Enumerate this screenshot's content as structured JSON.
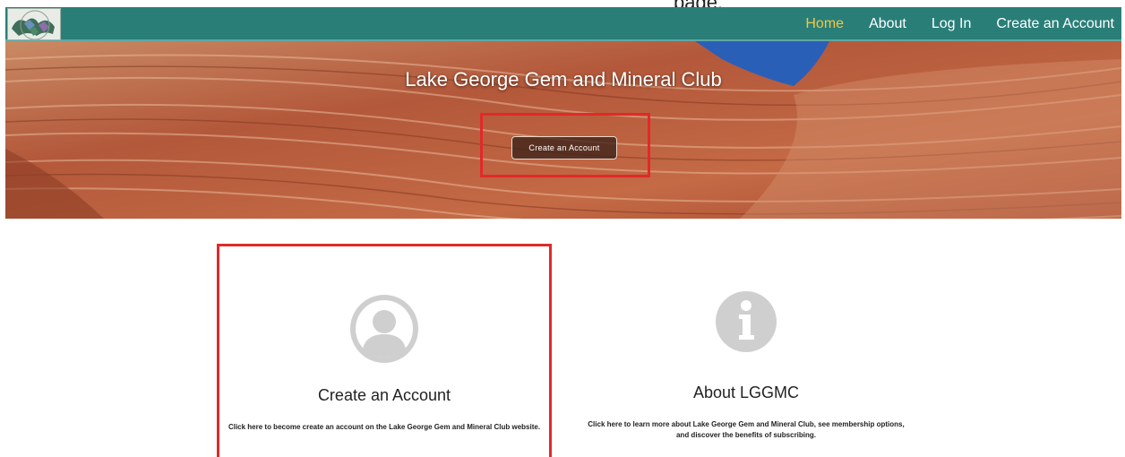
{
  "top_strip": {
    "tail_text": "page."
  },
  "nav": {
    "items": [
      {
        "label": "Home",
        "active": true
      },
      {
        "label": "About",
        "active": false
      },
      {
        "label": "Log In",
        "active": false
      },
      {
        "label": "Create an Account",
        "active": false
      }
    ],
    "bar_color": "#2a7e78",
    "active_color": "#f2c744"
  },
  "hero": {
    "title": "Lake George Gem and Mineral Club",
    "button_label": "Create an Account",
    "highlight_color": "#e02a2a"
  },
  "cards": [
    {
      "icon": "user-circle-icon",
      "title": "Create an Account",
      "description": "Click here to become create an account on the Lake George Gem and Mineral Club website."
    },
    {
      "icon": "info-circle-icon",
      "title": "About LGGMC",
      "description": "Click here to learn more about Lake George Gem and Mineral Club, see membership options, and discover the benefits of subscribing."
    }
  ]
}
